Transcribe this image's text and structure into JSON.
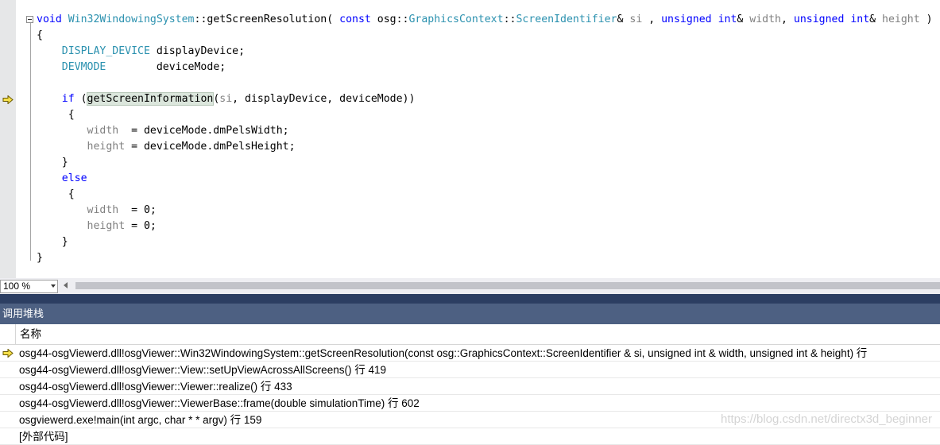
{
  "editor": {
    "lines": [
      [
        [
          "kw",
          "void "
        ],
        [
          "ty",
          "Win32WindowingSystem"
        ],
        [
          "",
          "::getScreenResolution( "
        ],
        [
          "kw",
          "const "
        ],
        [
          "",
          "osg::"
        ],
        [
          "ty",
          "GraphicsContext"
        ],
        [
          "",
          "::"
        ],
        [
          "ty",
          "ScreenIdentifier"
        ],
        [
          "",
          "& "
        ],
        [
          "pa",
          "si"
        ],
        [
          "",
          " , "
        ],
        [
          "kw",
          "unsigned int"
        ],
        [
          "",
          "& "
        ],
        [
          "pa",
          "width"
        ],
        [
          "",
          ", "
        ],
        [
          "kw",
          "unsigned int"
        ],
        [
          "",
          "& "
        ],
        [
          "pa",
          "height"
        ],
        [
          "",
          " )"
        ]
      ],
      [
        [
          "",
          "{"
        ]
      ],
      [
        [
          "ty",
          "    DISPLAY_DEVICE"
        ],
        [
          "",
          " displayDevice;"
        ]
      ],
      [
        [
          "ty",
          "    DEVMODE"
        ],
        [
          "",
          "        deviceMode;"
        ]
      ],
      [
        [
          "",
          ""
        ]
      ],
      [
        [
          "kw",
          "    if"
        ],
        [
          "",
          " ("
        ],
        [
          "hl",
          "getScreenInformation"
        ],
        [
          "",
          "("
        ],
        [
          "pa",
          "si"
        ],
        [
          "",
          ", displayDevice, deviceMode))"
        ]
      ],
      [
        [
          "",
          "     {"
        ]
      ],
      [
        [
          "pa",
          "        width"
        ],
        [
          "",
          "  = deviceMode.dmPelsWidth;"
        ]
      ],
      [
        [
          "pa",
          "        height"
        ],
        [
          "",
          " = deviceMode.dmPelsHeight;"
        ]
      ],
      [
        [
          "",
          "    }"
        ]
      ],
      [
        [
          "kw",
          "    else"
        ]
      ],
      [
        [
          "",
          "     {"
        ]
      ],
      [
        [
          "pa",
          "        width"
        ],
        [
          "",
          "  = 0;"
        ]
      ],
      [
        [
          "pa",
          "        height"
        ],
        [
          "",
          " = 0;"
        ]
      ],
      [
        [
          "",
          "    }"
        ]
      ],
      [
        [
          "",
          "}"
        ]
      ]
    ],
    "zoom": "100 %"
  },
  "callstack": {
    "title": "调用堆栈",
    "column": "名称",
    "rows": [
      "osg44-osgViewerd.dll!osgViewer::Win32WindowingSystem::getScreenResolution(const osg::GraphicsContext::ScreenIdentifier & si, unsigned int & width, unsigned int & height) 行",
      "osg44-osgViewerd.dll!osgViewer::View::setUpViewAcrossAllScreens() 行 419",
      "osg44-osgViewerd.dll!osgViewer::Viewer::realize() 行 433",
      "osg44-osgViewerd.dll!osgViewer::ViewerBase::frame(double simulationTime) 行 602",
      "osgviewerd.exe!main(int argc, char * * argv) 行 159",
      "[外部代码]"
    ]
  },
  "watermark": "https://blog.csdn.net/directx3d_beginner",
  "colors": {
    "keyword": "#0000ff",
    "type": "#2b91af",
    "param": "#808080",
    "panel_title_bg": "#4d6082",
    "divider": "#2c3e62",
    "arrow_fill": "#f7e14a"
  }
}
